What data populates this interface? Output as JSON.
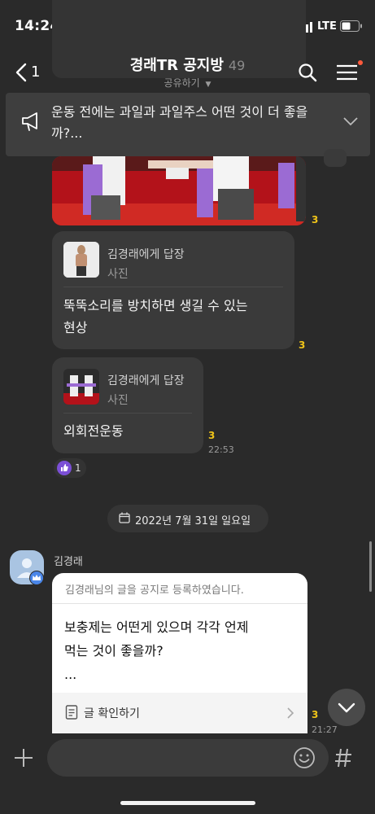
{
  "status_bar": {
    "time": "14:24",
    "network": "LTE"
  },
  "header": {
    "back_count": "1",
    "title": "경래TR 공지방",
    "member_count": "49",
    "share_label": "공유하기"
  },
  "notice": {
    "text": "운동 전에는 과일과 과일주스 어떤 것이 더 좋을까?..."
  },
  "messages": [
    {
      "unread": "3"
    },
    {
      "reply_to": "김경래에게 답장",
      "reply_type": "사진",
      "text_line1": "뚝뚝소리를 방치하면 생길 수 있는",
      "text_line2": "현상",
      "unread": "3"
    },
    {
      "reply_to": "김경래에게 답장",
      "reply_type": "사진",
      "text": "외회전운동",
      "unread": "3",
      "time": "22:53",
      "reaction_count": "1"
    }
  ],
  "date_divider": "2022년 7월 31일 일요일",
  "notice_card": {
    "sender": "김경래",
    "header": "김경래님의 글을 공지로 등록하였습니다.",
    "body_line1": "보충제는 어떤게 있으며 각각 언제",
    "body_line2": "먹는 것이 좋을까?",
    "body_line3": "...",
    "link_label": "글 확인하기",
    "unread": "3",
    "time": "21:27"
  },
  "colors": {
    "background": "#2a2a2a",
    "bubble": "#3a3a3a",
    "unread": "#f0c419",
    "reaction": "#7b4fd6",
    "notification_dot": "#ff5a3c"
  }
}
